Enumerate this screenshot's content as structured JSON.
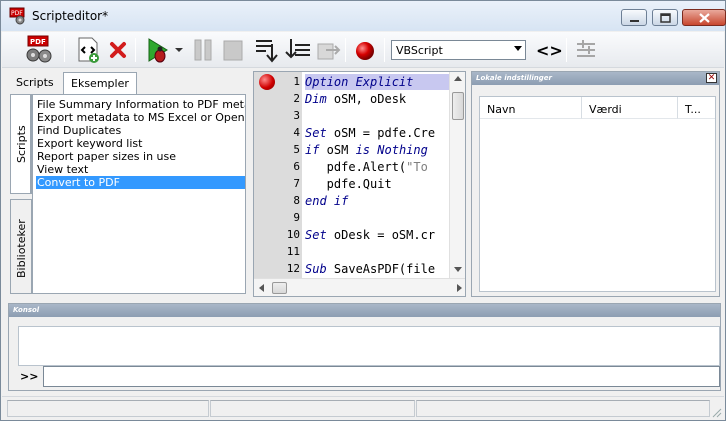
{
  "window": {
    "title": "Scripteditor*"
  },
  "toolbar": {
    "language_select": "VBScript",
    "tags_label": "<>",
    "buttons": [
      "pdf-gear",
      "insert-tag",
      "delete",
      "run",
      "pause",
      "stop",
      "step-into",
      "step-over",
      "step-out",
      "breakpoint"
    ]
  },
  "left": {
    "tabs": [
      "Scripts",
      "Eksempler"
    ],
    "vertical_tabs": [
      "Scripts",
      "Biblioteker"
    ],
    "scripts": [
      "File Summary Information to PDF metada",
      "Export metadata to MS Excel or OpenOff",
      "Find Duplicates",
      "Export keyword list",
      "Report paper sizes in use",
      "View text",
      "Convert to PDF"
    ],
    "selected_index": 6
  },
  "editor": {
    "lines": [
      {
        "no": "1",
        "text": "Option Explicit"
      },
      {
        "no": "2",
        "text": "Dim oSM, oDesk"
      },
      {
        "no": "3",
        "text": ""
      },
      {
        "no": "4",
        "text": "Set oSM = pdfe.Cre"
      },
      {
        "no": "5",
        "text": "if oSM is Nothing"
      },
      {
        "no": "6",
        "text": "   pdfe.Alert(\"To"
      },
      {
        "no": "7",
        "text": "   pdfe.Quit"
      },
      {
        "no": "8",
        "text": "end if"
      },
      {
        "no": "9",
        "text": ""
      },
      {
        "no": "10",
        "text": "Set oDesk = oSM.cr"
      },
      {
        "no": "11",
        "text": ""
      },
      {
        "no": "12",
        "text": "Sub SaveAsPDF(file"
      }
    ]
  },
  "local_settings": {
    "title": "Lokale indstillinger",
    "columns": [
      "Navn",
      "Værdi",
      "T..."
    ]
  },
  "console": {
    "title": "Konsol",
    "prompt": ">>",
    "input_value": ""
  },
  "colors": {
    "selection": "#3399ff",
    "panel_header": "#9aaabd",
    "keyword": "#00008b"
  }
}
